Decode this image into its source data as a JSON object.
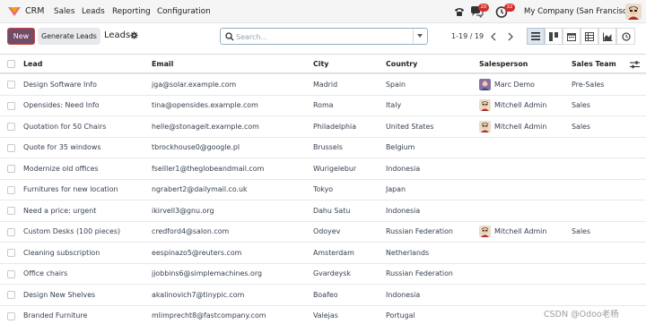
{
  "navbar": {
    "app_name": "CRM",
    "menu": [
      "Sales",
      "Leads",
      "Reporting",
      "Configuration"
    ],
    "messages_count": "20",
    "activities_count": "32",
    "company": "My Company (San Francisco)"
  },
  "control_panel": {
    "new_label": "New",
    "generate_label": "Generate Leads",
    "title": "Leads",
    "search_placeholder": "Search...",
    "pager": "1-19 / 19"
  },
  "table": {
    "columns": [
      "Lead",
      "Email",
      "City",
      "Country",
      "Salesperson",
      "Sales Team"
    ],
    "rows": [
      {
        "lead": "Design Software Info",
        "email": "jga@solar.example.com",
        "city": "Madrid",
        "country": "Spain",
        "salesperson": "Marc Demo",
        "team": "Pre-Sales"
      },
      {
        "lead": "Opensides: Need Info",
        "email": "tina@opensides.example.com",
        "city": "Roma",
        "country": "Italy",
        "salesperson": "Mitchell Admin",
        "team": "Sales"
      },
      {
        "lead": "Quotation for 50 Chairs",
        "email": "helle@stonageit.example.com",
        "city": "Philadelphia",
        "country": "United States",
        "salesperson": "Mitchell Admin",
        "team": "Sales"
      },
      {
        "lead": "Quote for 35 windows",
        "email": "tbrockhouse0@google.pl",
        "city": "Brussels",
        "country": "Belgium",
        "salesperson": "",
        "team": ""
      },
      {
        "lead": "Modernize old offices",
        "email": "fseiller1@theglobeandmail.com",
        "city": "Wurigelebur",
        "country": "Indonesia",
        "salesperson": "",
        "team": ""
      },
      {
        "lead": "Furnitures for new location",
        "email": "ngrabert2@dailymail.co.uk",
        "city": "Tokyo",
        "country": "Japan",
        "salesperson": "",
        "team": ""
      },
      {
        "lead": "Need a price: urgent",
        "email": "ikirvell3@gnu.org",
        "city": "Dahu Satu",
        "country": "Indonesia",
        "salesperson": "",
        "team": ""
      },
      {
        "lead": "Custom Desks (100 pieces)",
        "email": "credford4@salon.com",
        "city": "Odoyev",
        "country": "Russian Federation",
        "salesperson": "Mitchell Admin",
        "team": "Sales"
      },
      {
        "lead": "Cleaning subscription",
        "email": "eespinazo5@reuters.com",
        "city": "Amsterdam",
        "country": "Netherlands",
        "salesperson": "",
        "team": ""
      },
      {
        "lead": "Office chairs",
        "email": "jjobbins6@simplemachines.org",
        "city": "Gvardeysk",
        "country": "Russian Federation",
        "salesperson": "",
        "team": ""
      },
      {
        "lead": "Design New Shelves",
        "email": "akalinovich7@tinypic.com",
        "city": "Boafeo",
        "country": "Indonesia",
        "salesperson": "",
        "team": ""
      },
      {
        "lead": "Branded Furniture",
        "email": "mlimprecht8@fastcompany.com",
        "city": "Valejas",
        "country": "Portugal",
        "salesperson": "",
        "team": ""
      }
    ]
  },
  "watermark": "CSDN @Odoo老杨",
  "colors": {
    "brand": "#714b67",
    "badge": "#d0312d"
  }
}
